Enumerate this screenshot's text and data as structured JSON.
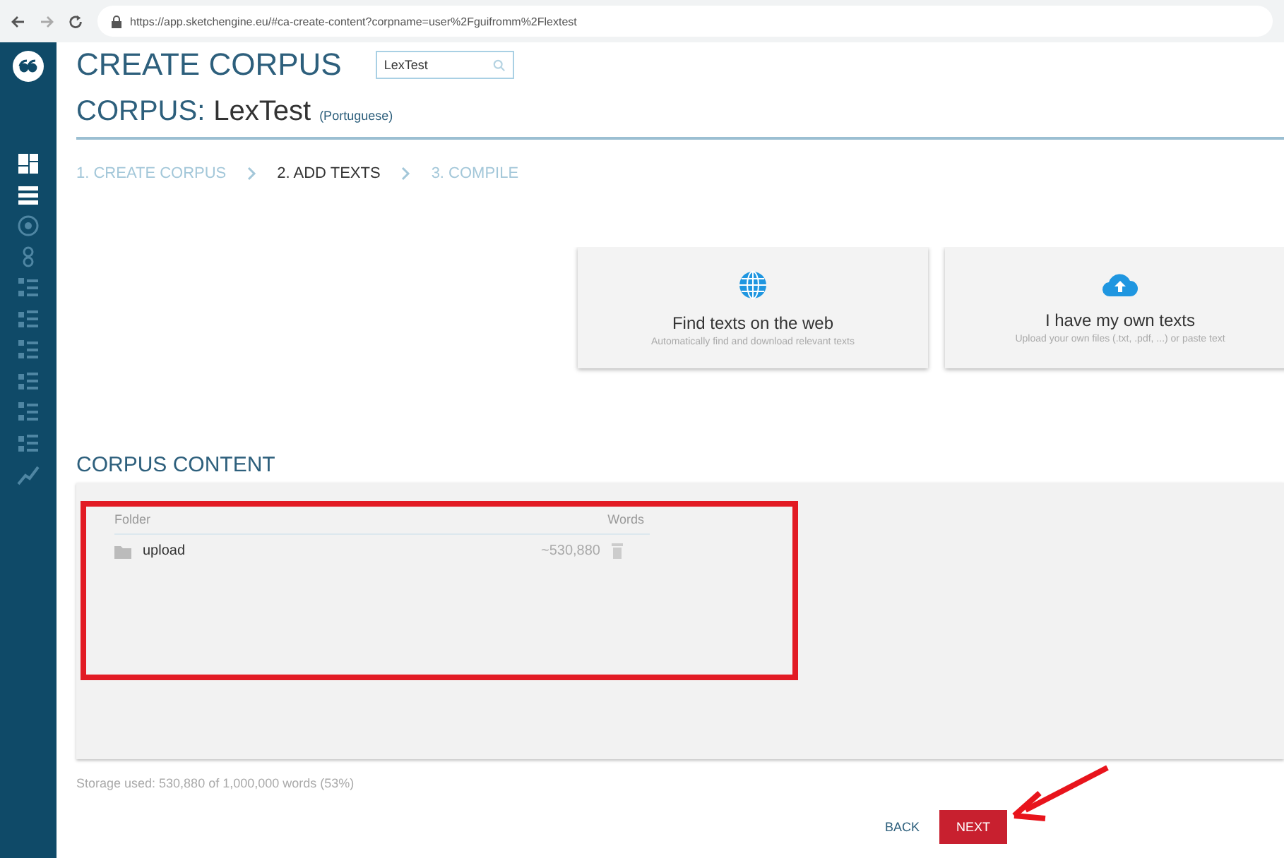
{
  "browser": {
    "url": "https://app.sketchengine.eu/#ca-create-content?corpname=user%2Fguifromm%2Flextest"
  },
  "sidebar": {
    "items": [
      {
        "enabled": true
      },
      {
        "enabled": true
      },
      {
        "enabled": false
      },
      {
        "enabled": false
      },
      {
        "enabled": false
      },
      {
        "enabled": false
      },
      {
        "enabled": false
      },
      {
        "enabled": false
      },
      {
        "enabled": false
      },
      {
        "enabled": false
      },
      {
        "enabled": false
      }
    ]
  },
  "header": {
    "title": "CREATE CORPUS",
    "search": {
      "value": "LexTest"
    }
  },
  "corpus": {
    "label": "CORPUS:",
    "name": "LexTest",
    "language": "(Portuguese)"
  },
  "steps": [
    {
      "label": "1. CREATE CORPUS",
      "selected": false
    },
    {
      "label": "2. ADD TEXTS",
      "selected": true
    },
    {
      "label": "3. COMPILE",
      "selected": false
    }
  ],
  "options": [
    {
      "kind": "web",
      "title": "Find texts on the web",
      "subtitle": "Automatically find and download relevant texts"
    },
    {
      "kind": "upload",
      "title": "I have my own texts",
      "subtitle": "Upload your own files (.txt, .pdf, ...) or paste text"
    }
  ],
  "content": {
    "title": "CORPUS CONTENT",
    "columns": [
      "Folder",
      "Words"
    ],
    "rows": [
      {
        "folder": "upload",
        "words": "~530,880"
      }
    ]
  },
  "storage": "Storage used: 530,880 of 1,000,000 words (53%)",
  "buttons": [
    {
      "label": "BACK",
      "kind": "flat"
    },
    {
      "label": "NEXT",
      "kind": "primary"
    }
  ]
}
